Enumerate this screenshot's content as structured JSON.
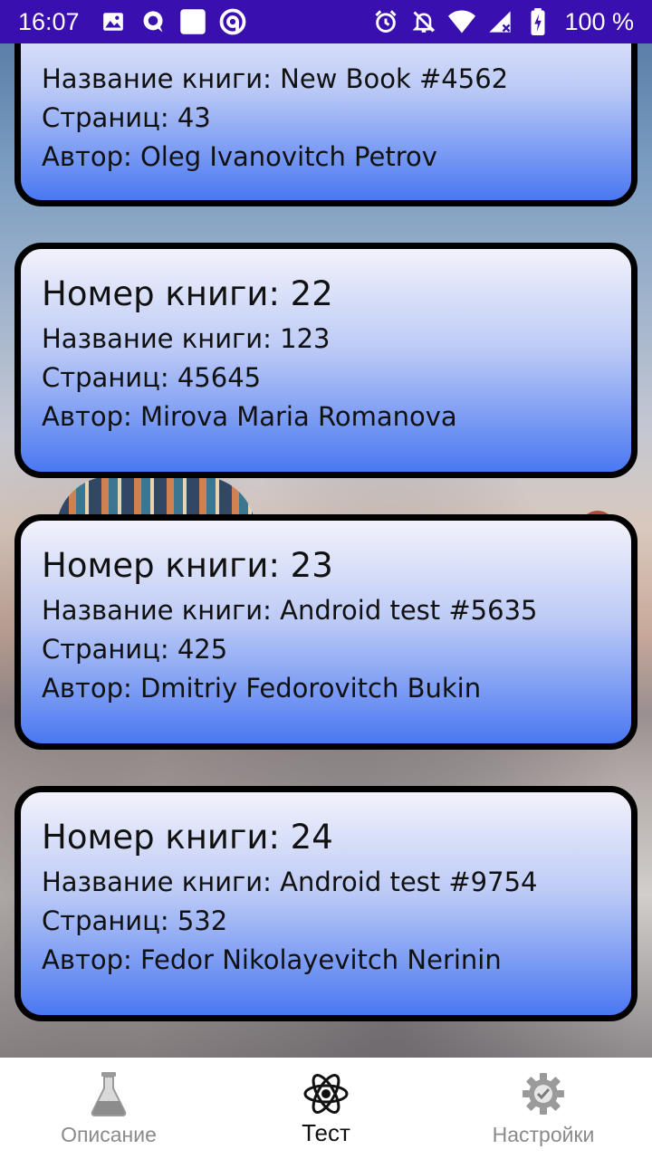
{
  "status_bar": {
    "time": "16:07",
    "battery": "100 %",
    "icons_left": [
      "image-icon",
      "chat-bubble-icon",
      "white-square-icon",
      "at-sign-icon"
    ],
    "icons_right": [
      "alarm-icon",
      "bell-off-icon",
      "wifi-icon",
      "signal-icon",
      "battery-charging-icon"
    ]
  },
  "books": [
    {
      "title": "Название книги: New Book #4562",
      "pages": "Страниц: 43",
      "author": "Автор: Oleg Ivanovitch Petrov"
    },
    {
      "number": "Номер книги: 22",
      "title": "Название книги: 123",
      "pages": "Страниц: 45645",
      "author": "Автор: Mirova Maria Romanova"
    },
    {
      "number": "Номер книги: 23",
      "title": "Название книги: Android test #5635",
      "pages": "Страниц: 425",
      "author": "Автор: Dmitriy Fedorovitch Bukin"
    },
    {
      "number": "Номер книги: 24",
      "title": "Название книги: Android test #9754",
      "pages": "Страниц: 532",
      "author": "Автор: Fedor Nikolayevitch  Nerinin"
    }
  ],
  "nav": {
    "items": [
      {
        "label": "Описание",
        "icon": "flask-icon",
        "active": false
      },
      {
        "label": "Тест",
        "icon": "atom-icon",
        "active": true
      },
      {
        "label": "Настройки",
        "icon": "gear-check-icon",
        "active": false
      }
    ]
  },
  "colors": {
    "status_bar": "#3a0fb0",
    "card_gradient_top": "#f2f2fb",
    "card_gradient_bottom": "#4a78f2",
    "card_border": "#000000",
    "nav_inactive": "#8a8a8a",
    "nav_active": "#111111"
  }
}
